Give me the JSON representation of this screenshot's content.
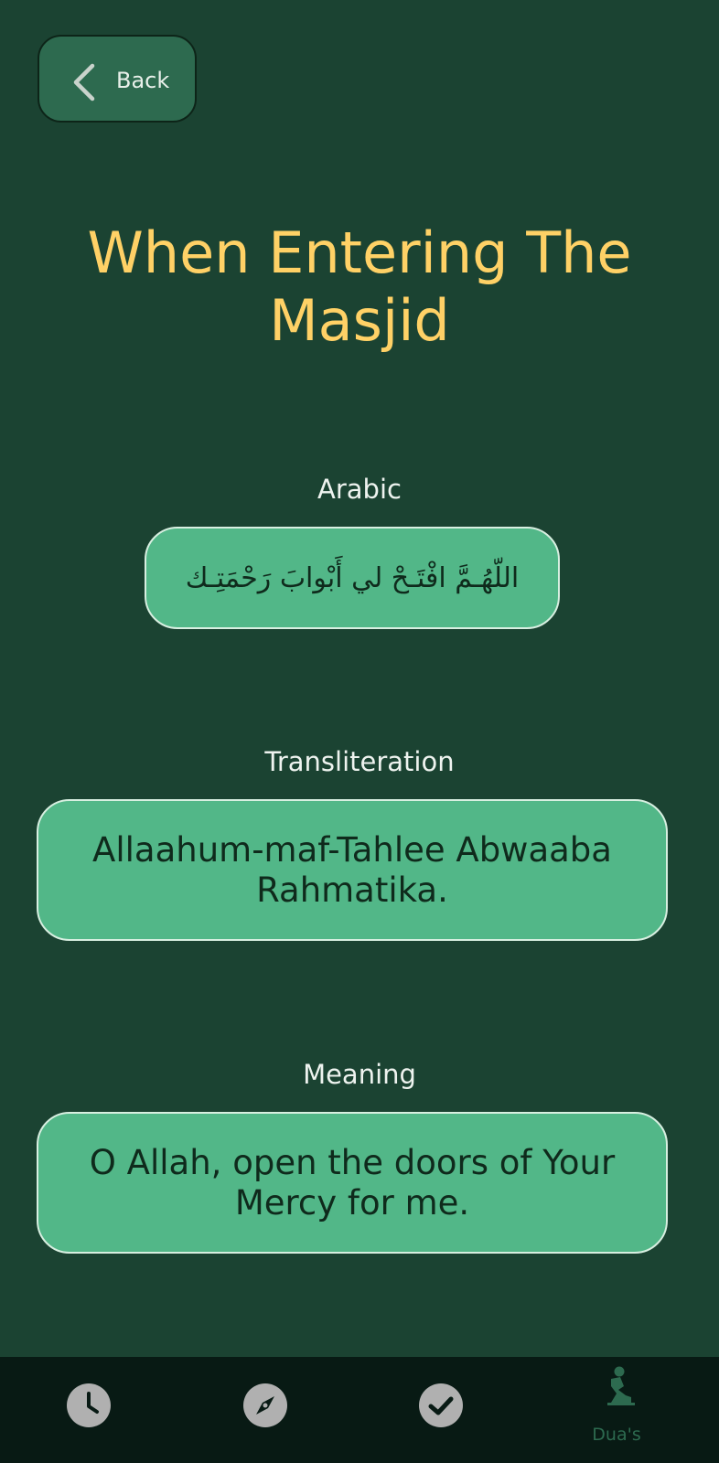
{
  "header": {
    "back_label": "Back"
  },
  "title": "When Entering The Masjid",
  "sections": [
    {
      "label": "Arabic",
      "text": "اللّهُـمَّ افْتَـحْ لي أَبْوابَ رَحْمَتِـك"
    },
    {
      "label": "Transliteration",
      "text": "Allaahum-maf-Tahlee Abwaaba Rahmatika."
    },
    {
      "label": "Meaning",
      "text": "O Allah, open the doors of Your Mercy for me."
    }
  ],
  "bottom_nav": {
    "items": [
      {
        "icon": "clock-icon",
        "label": ""
      },
      {
        "icon": "compass-icon",
        "label": ""
      },
      {
        "icon": "check-icon",
        "label": ""
      },
      {
        "icon": "praying-person-icon",
        "label": "Dua's",
        "active": true
      }
    ]
  },
  "colors": {
    "background": "#1b4332",
    "title": "#ffd166",
    "card": "#52b788",
    "button": "#2d6a4f",
    "nav_bg": "#081a14",
    "nav_icon": "#b0b0b0",
    "nav_active": "#2d6a4f"
  }
}
